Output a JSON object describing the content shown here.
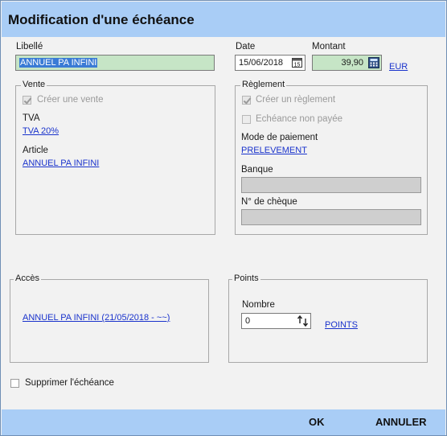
{
  "dialog": {
    "title": "Modification d'une échéance"
  },
  "libelle": {
    "label": "Libellé",
    "value": "ANNUEL PA INFINI"
  },
  "date": {
    "label": "Date",
    "value": "15/06/2018"
  },
  "montant": {
    "label": "Montant",
    "value": "39,90",
    "currency": "EUR"
  },
  "vente": {
    "legend": "Vente",
    "create_label": "Créer une vente",
    "tva_label": "TVA",
    "tva_value": "TVA 20%",
    "article_label": "Article",
    "article_value": "ANNUEL PA INFINI"
  },
  "reglement": {
    "legend": "Règlement",
    "create_label": "Créer un règlement",
    "unpaid_label": "Echéance non payée",
    "mode_label": "Mode de paiement",
    "mode_value": "PRELEVEMENT",
    "banque_label": "Banque",
    "banque_value": "",
    "cheque_label": "N° de chèque",
    "cheque_value": ""
  },
  "acces": {
    "legend": "Accès",
    "link": "ANNUEL PA INFINI (21/05/2018 - ~~)"
  },
  "points": {
    "legend": "Points",
    "nombre_label": "Nombre",
    "nombre_value": "0",
    "link": "POINTS"
  },
  "delete": {
    "label": "Supprimer l'échéance"
  },
  "footer": {
    "ok": "OK",
    "cancel": "ANNULER"
  }
}
